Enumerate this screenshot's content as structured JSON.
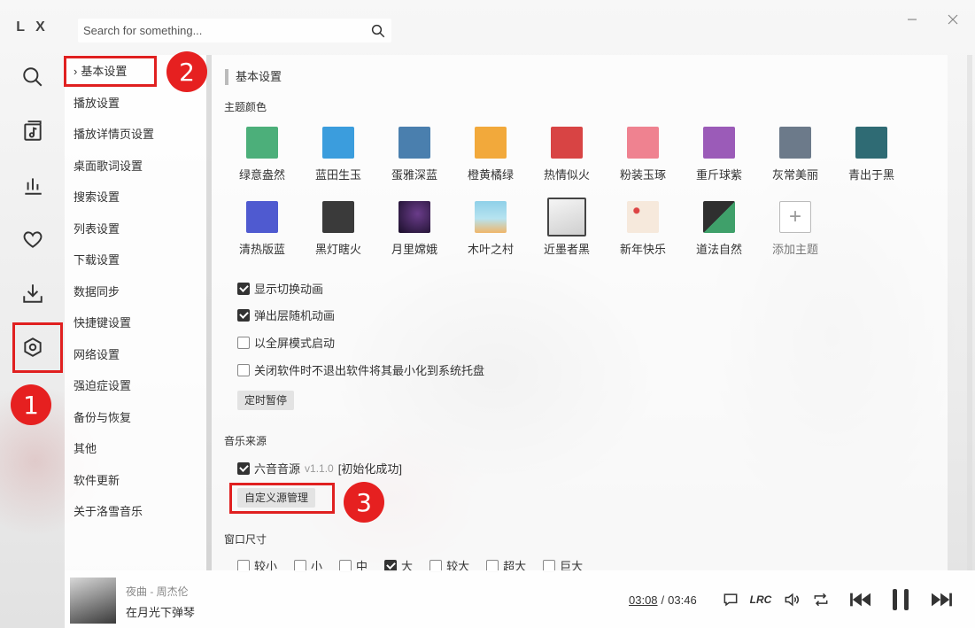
{
  "app": {
    "logo": "L X",
    "search_placeholder": "Search for something..."
  },
  "rail": {
    "icons": [
      "search-icon",
      "music-library-icon",
      "chart-icon",
      "heart-icon",
      "download-icon",
      "settings-icon"
    ]
  },
  "nav": {
    "items": [
      {
        "label": "基本设置",
        "active": true
      },
      {
        "label": "播放设置"
      },
      {
        "label": "播放详情页设置"
      },
      {
        "label": "桌面歌词设置"
      },
      {
        "label": "搜索设置"
      },
      {
        "label": "列表设置"
      },
      {
        "label": "下载设置"
      },
      {
        "label": "数据同步"
      },
      {
        "label": "快捷键设置"
      },
      {
        "label": "网络设置"
      },
      {
        "label": "强迫症设置"
      },
      {
        "label": "备份与恢复"
      },
      {
        "label": "其他"
      },
      {
        "label": "软件更新"
      },
      {
        "label": "关于洛雪音乐"
      }
    ]
  },
  "settings": {
    "title": "基本设置",
    "theme_section": "主题颜色",
    "themes": [
      {
        "label": "绿意盎然",
        "color": "#4caf7a"
      },
      {
        "label": "蓝田生玉",
        "color": "#3b9ddd"
      },
      {
        "label": "蛋雅深蓝",
        "color": "#4a7fae"
      },
      {
        "label": "橙黄橘绿",
        "color": "#f2a93b"
      },
      {
        "label": "热情似火",
        "color": "#d84444"
      },
      {
        "label": "粉装玉琢",
        "color": "#ef8290"
      },
      {
        "label": "重斤球紫",
        "color": "#9b5bb8"
      },
      {
        "label": "灰常美丽",
        "color": "#6c7a8a"
      },
      {
        "label": "青出于黑",
        "color": "#2f6b74"
      },
      {
        "label": "清热版蓝",
        "color": "#4f5ad0"
      },
      {
        "label": "黑灯瞎火",
        "color": "#3a3a3a"
      },
      {
        "label": "月里嫦娥",
        "color": "#2a1b3a"
      },
      {
        "label": "木叶之村",
        "color": "#8fd0e8"
      },
      {
        "label": "近墨者黑",
        "color": "#e8e8e8"
      },
      {
        "label": "新年快乐",
        "color": "#f6e9dc"
      },
      {
        "label": "道法自然",
        "color": "#2e6b4f"
      },
      {
        "label": "添加主题",
        "color": "#ffffff"
      }
    ],
    "options": [
      {
        "label": "显示切换动画",
        "checked": true
      },
      {
        "label": "弹出层随机动画",
        "checked": true
      },
      {
        "label": "以全屏模式启动",
        "checked": false
      },
      {
        "label": "关闭软件时不退出软件将其最小化到系统托盘",
        "checked": false
      }
    ],
    "timer_button": "定时暂停",
    "source_section": "音乐来源",
    "source": {
      "name": "六音音源",
      "version": "v1.1.0",
      "status": "[初始化成功]",
      "checked": true
    },
    "custom_source_button": "自定义源管理",
    "window_size_section": "窗口尺寸",
    "window_sizes": [
      {
        "label": "较小",
        "checked": false
      },
      {
        "label": "小",
        "checked": false
      },
      {
        "label": "中",
        "checked": false
      },
      {
        "label": "大",
        "checked": true
      },
      {
        "label": "较大",
        "checked": false
      },
      {
        "label": "超大",
        "checked": false
      },
      {
        "label": "巨大",
        "checked": false
      }
    ]
  },
  "annotations": {
    "marker1": "1",
    "marker2": "2",
    "marker3": "3",
    "color": "#e02020"
  },
  "player": {
    "song_meta": "夜曲 - 周杰伦",
    "lyric_line": "在月光下弹琴",
    "current_time": "03:08",
    "separator": "/",
    "total_time": "03:46",
    "lrc_label": "LRC"
  }
}
